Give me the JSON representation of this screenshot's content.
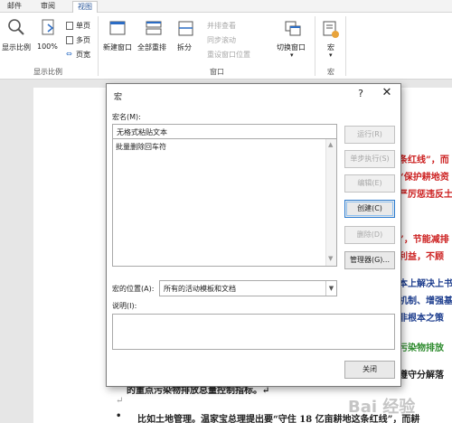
{
  "ribbon": {
    "tabs": [
      "邮件",
      "审阅",
      "视图"
    ],
    "zoom_group": {
      "zoom_button": "显示比例",
      "hundred": "100%",
      "one_page": "单页",
      "multi_page": "多页",
      "page_width": "页宽",
      "group_label": "显示比例"
    },
    "window_group": {
      "new_window": "新建窗口",
      "arrange_all": "全部重排",
      "split": "拆分",
      "side_by_side": "并排查看",
      "sync_scroll": "同步滚动",
      "reset_position": "重设窗口位置",
      "switch_window": "切换窗口",
      "group_label": "窗口"
    },
    "macro_group": {
      "macros": "宏",
      "group_label": "宏"
    }
  },
  "dialog": {
    "title": "宏",
    "help": "?",
    "close": "✕",
    "macro_name_label": "宏名(M):",
    "macro_name_value": "无格式粘贴文本",
    "macros_list": [
      "批量删除回车符"
    ],
    "buttons": {
      "run": "运行(R)",
      "step_into": "单步执行(S)",
      "edit": "编辑(E)",
      "create": "创建(C)",
      "delete": "删除(D)",
      "organizer": "管理器(G)...",
      "close": "关闭"
    },
    "macros_in_label": "宏的位置(A):",
    "macros_in_value": "所有的活动模板和文档",
    "description_label": "说明(I):"
  },
  "document": {
    "lines_right": [
      {
        "text": "条红线”，而",
        "color": "red"
      },
      {
        "text": "“保护耕地资",
        "color": "red"
      },
      {
        "text": "严厉惩违反土地",
        "color": "red"
      },
      {
        "text": "”，节能减排",
        "color": "red"
      },
      {
        "text": "利益，不顾",
        "color": "red"
      },
      {
        "text": "本上解决上书",
        "color": "blue"
      },
      {
        "text": "机制、增强基",
        "color": "blue"
      },
      {
        "text": "非根本之策",
        "color": "blue"
      },
      {
        "text": "污染物排放",
        "color": "green"
      },
      {
        "text": "遵守分解落",
        "color": "black"
      }
    ],
    "line_bottom_a": "的重点污染物排放总量控制指标。↵",
    "line_bottom_b": "↵",
    "bullet_line": "比如土地管理。温家宝总理提出要“守住 18 亿亩耕地这条红线”，而耕"
  },
  "watermark": "Bai 经验"
}
